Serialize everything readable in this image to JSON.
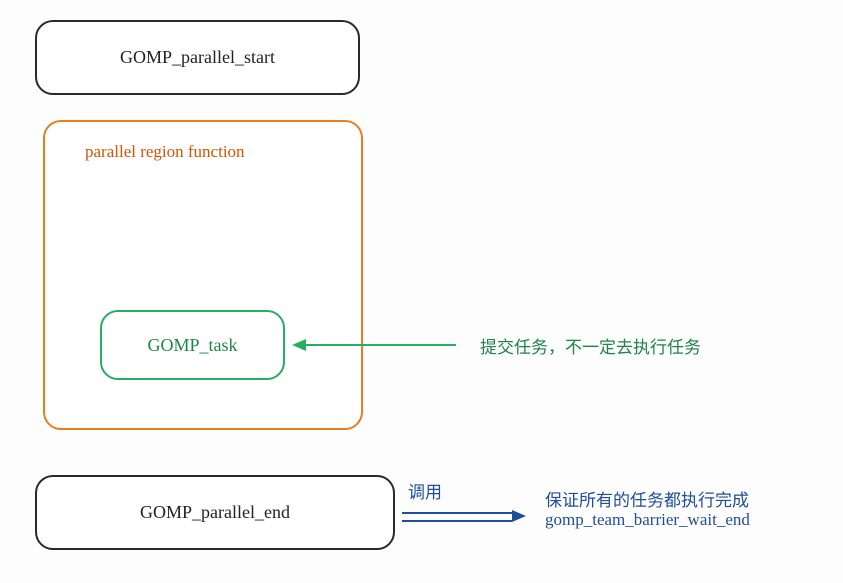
{
  "boxes": {
    "parallel_start": {
      "label": "GOMP_parallel_start"
    },
    "region": {
      "label": "parallel region function"
    },
    "task": {
      "label": "GOMP_task"
    },
    "parallel_end": {
      "label": "GOMP_parallel_end"
    }
  },
  "annotations": {
    "task_note": "提交任务，不一定去执行任务",
    "end_call_label": "调用",
    "end_guarantee": "保证所有的任务都执行完成",
    "barrier_fn": "gomp_team_barrier_wait_end"
  }
}
